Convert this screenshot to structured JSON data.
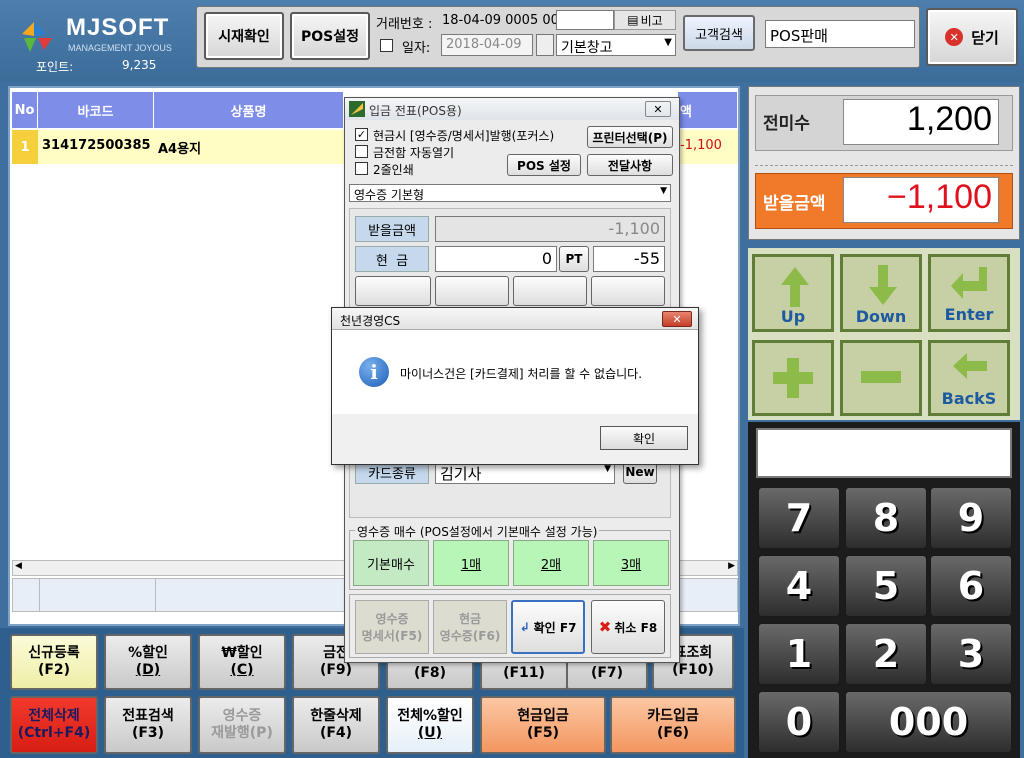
{
  "app": {
    "logo_main": "MJSOFT",
    "logo_sub": "MANAGEMENT JOYOUS",
    "points_label": "포인트:",
    "points_value": "9,235"
  },
  "toolbar": {
    "stock_check": "시재확인",
    "pos_settings": "POS설정",
    "trade_no_label": "거래번호 :",
    "trade_no": "18-04-09 0005 00",
    "memo_label": "비고",
    "date_label": "일자:",
    "date_value": "2018-04-09",
    "warehouse": "기본창고",
    "customer_search": "고객검색",
    "mode_label": "POS판매",
    "close": "닫기"
  },
  "grid": {
    "headers": {
      "no": "No",
      "barcode": "바코드",
      "name": "상품명"
    },
    "rows": [
      {
        "no": "1",
        "barcode": "314172500385",
        "name": "A4용지",
        "amount": "-1,100"
      }
    ],
    "amount_fragment": "액"
  },
  "right": {
    "prev_label": "전미수",
    "prev_value": "1,200",
    "receive_label": "받을금액",
    "receive_value": "−1,100"
  },
  "nav": {
    "up": "Up",
    "down": "Down",
    "enter": "Enter",
    "plus": "+",
    "minus": "−",
    "back": "BackS"
  },
  "numpad": {
    "n7": "7",
    "n8": "8",
    "n9": "9",
    "n4": "4",
    "n5": "5",
    "n6": "6",
    "n1": "1",
    "n2": "2",
    "n3": "3",
    "n0": "0",
    "n000": "000"
  },
  "fkeys": {
    "new_reg": [
      "신규등록",
      "(F2)"
    ],
    "pct_disc": [
      "%할인",
      "(D)"
    ],
    "won_disc": [
      "₩할인",
      "(C)"
    ],
    "f9": [
      "금전",
      "(F9)"
    ],
    "f8": "(F8)",
    "f11": "(F11)",
    "f7": "(F7)",
    "f10": [
      "표조회",
      "(F10)"
    ],
    "del_all": [
      "전체삭제",
      "(Ctrl+F4)"
    ],
    "slip_search": [
      "전표검색",
      "(F3)"
    ],
    "reissue": [
      "영수증",
      "재발행(P)"
    ],
    "del_one": [
      "한줄삭제",
      "(F4)"
    ],
    "all_pct": [
      "전체%할인",
      "(U)"
    ],
    "cash_in": [
      "현금입금",
      "(F5)"
    ],
    "card_in": [
      "카드입금",
      "(F6)"
    ]
  },
  "pos_dialog": {
    "title": "입금 전표(POS용)",
    "opt1": "현금시 [영수증/명세서]발행(포커스)",
    "opt2": "금전함 자동열기",
    "opt3": "2줄인쇄",
    "printer_btn": "프린터선택(P)",
    "pos_settings_btn": "POS 설정",
    "notice_btn": "전달사항",
    "receipt_type": "영수증 기본형",
    "amount_label": "받을금액",
    "amount_value": "-1,100",
    "cash_label": "현  금",
    "cash_value": "0",
    "pt_label": "PT",
    "pt_value": "-55",
    "card_label": "카드종류",
    "card_value": "김기사",
    "new_btn": "New",
    "copies_title": "영수증 매수 (POS설정에서 기본매수 설정 가능)",
    "copies": [
      "기본매수",
      "1매",
      "2매",
      "3매"
    ],
    "btn_stmt": [
      "영수증",
      "명세서(F5)"
    ],
    "btn_cashrcpt": [
      "현금",
      "영수증(F6)"
    ],
    "btn_ok": "확인 F7",
    "btn_cancel": "취소 F8"
  },
  "msg_dialog": {
    "title": "천년경영CS",
    "message": "마이너스건은 [카드결제] 처리를 할 수 없습니다.",
    "ok": "확인"
  },
  "colors": {
    "accent_blue": "#3f6f9c",
    "grid_header": "#7d8de8",
    "receive_orange": "#f07a2a",
    "delete_red": "#e8271c",
    "cash_orange": "#f5a672",
    "nav_green": "#5f7d36"
  }
}
